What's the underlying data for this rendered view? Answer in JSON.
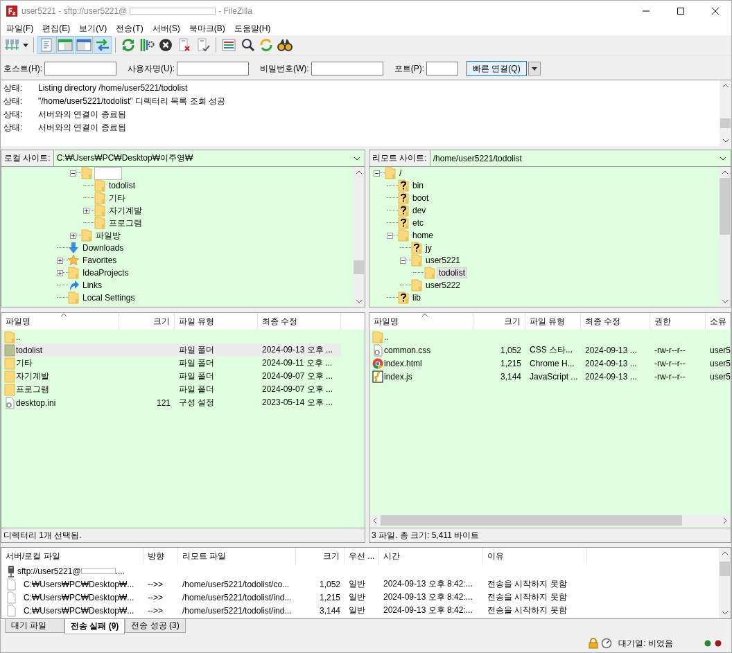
{
  "window": {
    "title_start": "user5221 - sftp://user5221@",
    "title_end": "- FileZilla"
  },
  "menu": [
    "파일(F)",
    "편집(E)",
    "보기(V)",
    "전송(T)",
    "서버(S)",
    "북마크(B)",
    "도움말(H)"
  ],
  "view_toggles": [
    {
      "on": true
    },
    {
      "on": true
    },
    {
      "on": true
    },
    {
      "on": true
    }
  ],
  "quickconnect": {
    "fields": [
      {
        "label": "호스트(H):"
      },
      {
        "label": "사용자명(U):"
      },
      {
        "label": "비밀번호(W):"
      },
      {
        "label": "포트(P):"
      }
    ],
    "button": "빠른 연결(Q)"
  },
  "log": [
    {
      "label": "상태:",
      "message": "Listing directory /home/user5221/todolist"
    },
    {
      "label": "상태:",
      "message": "\"/home/user5221/todolist\" 디렉터리 목록 조회 성공"
    },
    {
      "label": "상태:",
      "message": "서버와의 연결이 종료됨"
    },
    {
      "label": "상태:",
      "message": "서버와의 연결이 종료됨"
    }
  ],
  "local": {
    "site_label": "로컬 사이트:",
    "path": "C:₩Users₩PC₩Desktop₩이주영₩",
    "tree": [
      {
        "children": [
          {
            "kind": "folder",
            "redacted": true,
            "expanded": true,
            "children": [
              {
                "kind": "folder",
                "label": "todolist",
                "selected": false
              },
              {
                "kind": "folder",
                "label": "기타",
                "selected": false
              },
              {
                "kind": "folder",
                "label": "자기계발",
                "expanded": false,
                "selected": false
              },
              {
                "kind": "folder",
                "label": "프로그램",
                "selected": false
              }
            ]
          },
          {
            "kind": "folder",
            "label": "파일방",
            "expanded": false,
            "selected": false
          }
        ]
      },
      {
        "kind": "download",
        "label": "Downloads",
        "selected": false
      },
      {
        "kind": "star",
        "label": "Favorites",
        "expanded": false,
        "selected": false
      },
      {
        "kind": "folder",
        "label": "IdeaProjects",
        "expanded": false,
        "selected": false
      },
      {
        "kind": "link",
        "label": "Links",
        "selected": false
      },
      {
        "kind": "folder",
        "label": "Local Settings",
        "selected": false
      }
    ],
    "columns": [
      {
        "label": "파일명",
        "sorted": true
      },
      {
        "label": "크기",
        "sorted": false
      },
      {
        "label": "파일 유형",
        "sorted": false
      },
      {
        "label": "최종 수정",
        "sorted": false
      }
    ],
    "rows": [
      {
        "kind": "parent",
        "cells": [
          ".."
        ],
        "selected": false
      },
      {
        "kind": "folder",
        "cells": [
          "todolist",
          "",
          "파일 폴더",
          "2024-09-13 오후 ..."
        ],
        "selected": true
      },
      {
        "kind": "folder",
        "cells": [
          "기타",
          "",
          "파일 폴더",
          "2024-09-11 오후 ..."
        ],
        "selected": false
      },
      {
        "kind": "folder",
        "cells": [
          "자기계발",
          "",
          "파일 폴더",
          "2024-09-07 오후 ..."
        ],
        "selected": false
      },
      {
        "kind": "folder",
        "cells": [
          "프로그램",
          "",
          "파일 폴더",
          "2024-09-07 오후 ..."
        ],
        "selected": false
      },
      {
        "kind": "config",
        "cells": [
          "desktop.ini",
          "121",
          "구성 설정",
          "2023-05-14 오후 ..."
        ],
        "selected": false
      }
    ],
    "status": "디렉터리 1개 선택됨."
  },
  "remote": {
    "site_label": "리모트 사이트:",
    "path": "/home/user5221/todolist",
    "tree": [
      {
        "kind": "folder",
        "label": "/",
        "expanded": true,
        "selected": false,
        "children": [
          {
            "kind": "unknown",
            "label": "bin",
            "selected": false
          },
          {
            "kind": "unknown",
            "label": "boot",
            "selected": false
          },
          {
            "kind": "unknown",
            "label": "dev",
            "selected": false
          },
          {
            "kind": "unknown",
            "label": "etc",
            "selected": false
          },
          {
            "kind": "folder",
            "label": "home",
            "expanded": true,
            "selected": false,
            "children": [
              {
                "kind": "unknown",
                "label": "jy",
                "selected": false
              },
              {
                "kind": "folder",
                "label": "user5221",
                "expanded": true,
                "selected": false,
                "children": [
                  {
                    "kind": "folder",
                    "label": "todolist",
                    "selected": true
                  }
                ]
              },
              {
                "kind": "folder",
                "label": "user5222",
                "selected": false
              }
            ]
          },
          {
            "kind": "unknown",
            "label": "lib",
            "selected": false
          }
        ]
      }
    ],
    "columns": [
      {
        "label": "파일명",
        "sorted": true
      },
      {
        "label": "크기",
        "sorted": false
      },
      {
        "label": "파일 유형",
        "sorted": false
      },
      {
        "label": "최종 수정",
        "sorted": false
      },
      {
        "label": "권한",
        "sorted": false
      },
      {
        "label": "소유",
        "sorted": false
      }
    ],
    "rows": [
      {
        "kind": "parent",
        "cells": [
          ".."
        ],
        "selected": false
      },
      {
        "kind": "config",
        "cells": [
          "common.css",
          "1,052",
          "CSS 스타...",
          "2024-09-13 ...",
          "-rw-r--r--",
          "user5"
        ],
        "selected": false
      },
      {
        "kind": "chrome",
        "cells": [
          "index.html",
          "1,215",
          "Chrome H...",
          "2024-09-13 ...",
          "-rw-r--r--",
          "user5"
        ],
        "selected": false
      },
      {
        "kind": "script",
        "cells": [
          "index.js",
          "3,144",
          "JavaScript ...",
          "2024-09-13 ...",
          "-rw-r--r--",
          "user5"
        ],
        "selected": false
      }
    ],
    "status": "3 파일. 총 크기: 5,411 바이트"
  },
  "queue": {
    "columns": [
      "서버/로컬 파일",
      "방향",
      "리모트 파일",
      "크기",
      "우선 ...",
      "시간",
      "이유"
    ],
    "server": {
      "name_start": "sftp://user5221@",
      "name_end": "...."
    },
    "rows": [
      {
        "cells": [
          "C:₩Users₩PC₩Desktop₩...",
          "-->>",
          "/home/user5221/todolist/co...",
          "1,052",
          "일반",
          "2024-09-13 오후 8:42:...",
          "전송을 시작하지 못함"
        ]
      },
      {
        "cells": [
          "C:₩Users₩PC₩Desktop₩...",
          "-->>",
          "/home/user5221/todolist/ind...",
          "1,215",
          "일반",
          "2024-09-13 오후 8:42:...",
          "전송을 시작하지 못함"
        ]
      },
      {
        "cells": [
          "C:₩Users₩PC₩Desktop₩...",
          "-->>",
          "/home/user5221/todolist/ind...",
          "3,144",
          "일반",
          "2024-09-13 오후 8:42:...",
          "전송을 시작하지 못함"
        ]
      }
    ],
    "tabs": [
      {
        "label": "대기 파일",
        "selected": false
      },
      {
        "label": "전송 실패 (9)",
        "selected": true
      },
      {
        "label": "전송 성공 (3)",
        "selected": false
      }
    ]
  },
  "status_bar": {
    "queue": "대기열: 비었음"
  }
}
